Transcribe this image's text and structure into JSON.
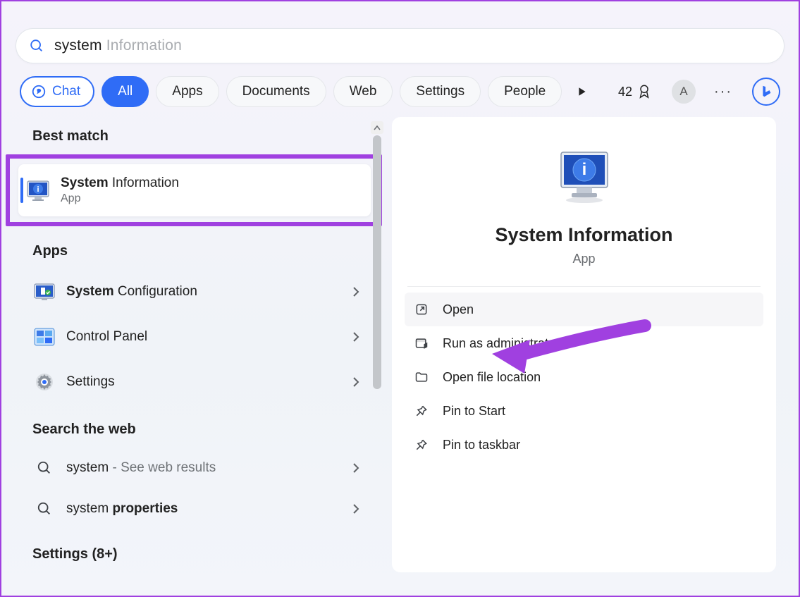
{
  "search": {
    "typed": "system",
    "ghost": " Information"
  },
  "filters": {
    "chat": "Chat",
    "all": "All",
    "apps": "Apps",
    "documents": "Documents",
    "web": "Web",
    "settings": "Settings",
    "people": "People"
  },
  "header": {
    "rewards_count": "42",
    "avatar_initial": "A"
  },
  "left": {
    "best_match_h": "Best match",
    "best": {
      "title_bold": "System",
      "title_rest": " Information",
      "sub": "App"
    },
    "apps_h": "Apps",
    "apps": [
      {
        "bold": "System",
        "rest": " Configuration"
      },
      {
        "bold": "",
        "rest": "Control Panel"
      },
      {
        "bold": "",
        "rest": "Settings"
      }
    ],
    "web_h": "Search the web",
    "web": [
      {
        "main": "system",
        "suffix": " - See web results"
      },
      {
        "main": "system ",
        "bold": "properties"
      }
    ],
    "settings_h": "Settings (8+)"
  },
  "right": {
    "title": "System Information",
    "sub": "App",
    "actions": {
      "open": "Open",
      "admin": "Run as administrator",
      "location": "Open file location",
      "pin_start": "Pin to Start",
      "pin_taskbar": "Pin to taskbar"
    }
  }
}
